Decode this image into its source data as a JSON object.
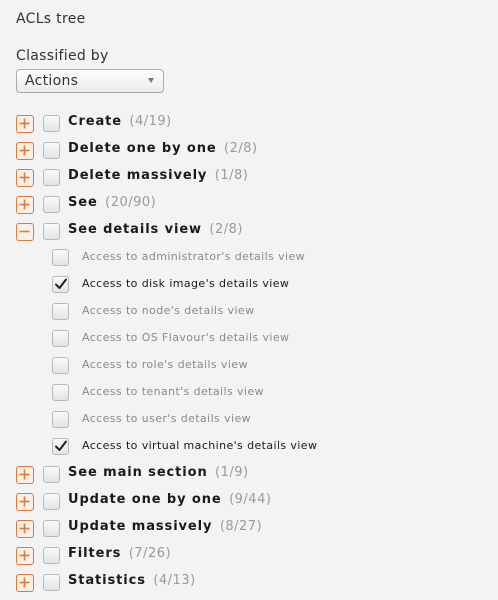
{
  "panel": {
    "title": "ACLs tree",
    "classified_label": "Classified by",
    "classified_value": "Actions"
  },
  "colors": {
    "toggle_accent": "#e07a3b",
    "background": "#f3f3f3"
  },
  "icons": {
    "expand": "plus-box-icon",
    "collapse": "minus-box-icon",
    "check": "checkmark-icon",
    "dropdown": "caret-down-icon"
  },
  "tree": [
    {
      "label": "Create",
      "count": "(4/19)",
      "expanded": false,
      "checked": false
    },
    {
      "label": "Delete one by one",
      "count": "(2/8)",
      "expanded": false,
      "checked": false
    },
    {
      "label": "Delete massively",
      "count": "(1/8)",
      "expanded": false,
      "checked": false
    },
    {
      "label": "See",
      "count": "(20/90)",
      "expanded": false,
      "checked": false
    },
    {
      "label": "See details view",
      "count": "(2/8)",
      "expanded": true,
      "checked": false,
      "children": [
        {
          "label": "Access to administrator's details view",
          "checked": false
        },
        {
          "label": "Access to disk image's details view",
          "checked": true
        },
        {
          "label": "Access to node's details view",
          "checked": false
        },
        {
          "label": "Access to OS Flavour's details view",
          "checked": false
        },
        {
          "label": "Access to role's details view",
          "checked": false
        },
        {
          "label": "Access to tenant's details view",
          "checked": false
        },
        {
          "label": "Access to user's details view",
          "checked": false
        },
        {
          "label": "Access to virtual machine's details view",
          "checked": true
        }
      ]
    },
    {
      "label": "See main section",
      "count": "(1/9)",
      "expanded": false,
      "checked": false
    },
    {
      "label": "Update one by one",
      "count": "(9/44)",
      "expanded": false,
      "checked": false
    },
    {
      "label": "Update massively",
      "count": "(8/27)",
      "expanded": false,
      "checked": false
    },
    {
      "label": "Filters",
      "count": "(7/26)",
      "expanded": false,
      "checked": false
    },
    {
      "label": "Statistics",
      "count": "(4/13)",
      "expanded": false,
      "checked": false
    }
  ]
}
